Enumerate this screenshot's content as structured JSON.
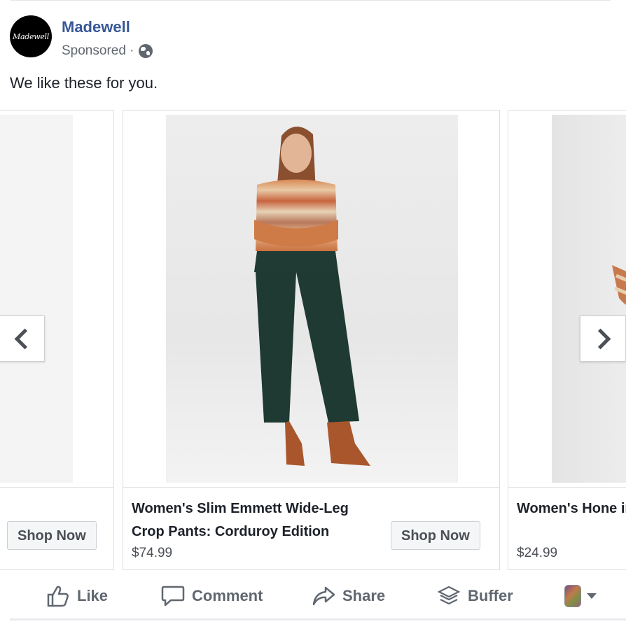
{
  "post": {
    "page_name": "Madewell",
    "avatar_text": "Madewell",
    "sponsored_label": "Sponsored ·",
    "message": "We like these for you."
  },
  "carousel": {
    "cards": [
      {
        "title": "",
        "price": "",
        "cta": "Shop Now"
      },
      {
        "title": "Women's Slim Emmett Wide-Leg Crop Pants: Corduroy Edition",
        "price": "$74.99",
        "cta": "Shop Now"
      },
      {
        "title": "Women's Hone in Kasson Strip",
        "price": "$24.99",
        "cta": ""
      }
    ]
  },
  "actions": {
    "like": "Like",
    "comment": "Comment",
    "share": "Share",
    "buffer": "Buffer"
  },
  "icons": {
    "globe": "globe-icon",
    "prev": "chevron-left-icon",
    "next": "chevron-right-icon",
    "like": "thumbs-up-icon",
    "comment": "speech-bubble-icon",
    "share": "share-arrow-icon",
    "buffer": "buffer-stack-icon",
    "menu": "caret-down-icon"
  },
  "colors": {
    "link": "#385898",
    "action_text": "#606770",
    "border": "#dddfe2"
  }
}
